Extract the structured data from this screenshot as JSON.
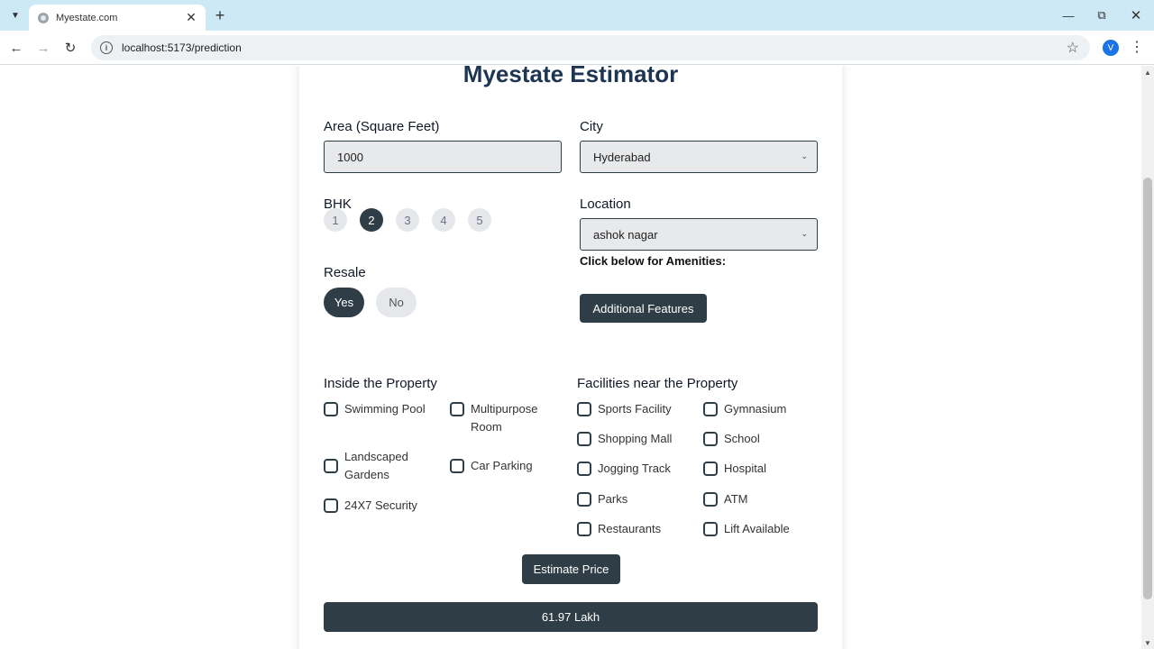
{
  "browser": {
    "tab_title": "Myestate.com",
    "url": "localhost:5173/prediction",
    "profile_initial": "V"
  },
  "page": {
    "title": "Myestate Estimator",
    "area": {
      "label": "Area (Square Feet)",
      "value": "1000"
    },
    "city": {
      "label": "City",
      "value": "Hyderabad"
    },
    "bhk": {
      "label": "BHK",
      "options": [
        "1",
        "2",
        "3",
        "4",
        "5"
      ],
      "selected": "2"
    },
    "location": {
      "label": "Location",
      "value": "ashok nagar"
    },
    "resale": {
      "label": "Resale",
      "options": [
        "Yes",
        "No"
      ],
      "selected": "Yes"
    },
    "amenities_prompt": "Click below for Amenities:",
    "additional_features_label": "Additional Features",
    "inside_title": "Inside the Property",
    "inside_items": [
      "Swimming Pool",
      "Multipurpose Room",
      "Landscaped Gardens",
      "Car Parking",
      "24X7 Security"
    ],
    "facilities_title": "Facilities near the Property",
    "facilities_items": [
      "Sports Facility",
      "Gymnasium",
      "Shopping Mall",
      "School",
      "Jogging Track",
      "Hospital",
      "Parks",
      "ATM",
      "Restaurants",
      "Lift Available"
    ],
    "estimate_button": "Estimate Price",
    "result": "61.97 Lakh"
  },
  "colors": {
    "primary_dark": "#2f3e46",
    "title": "#1e3552",
    "tabbar": "#cde9f5"
  }
}
